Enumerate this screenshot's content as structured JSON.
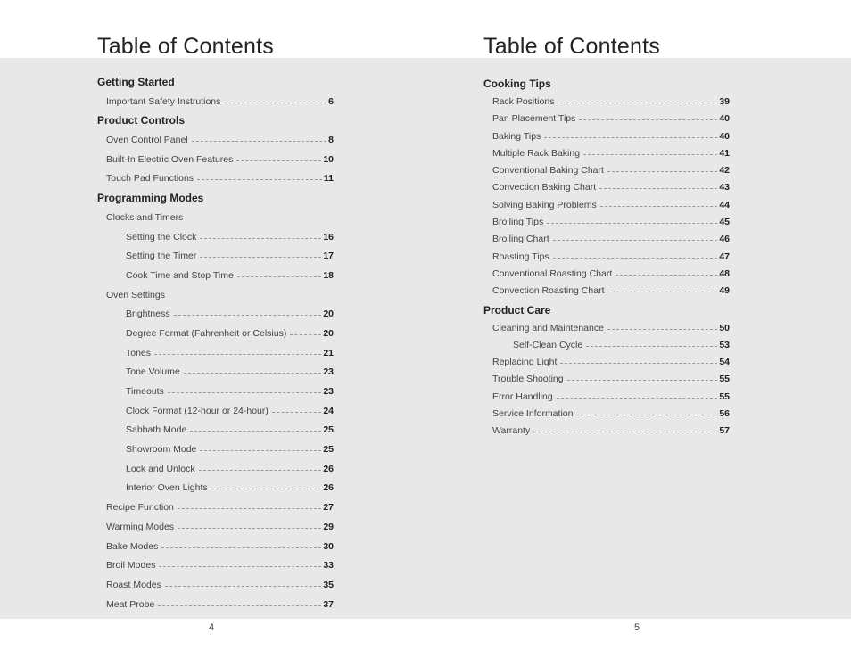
{
  "left_page": {
    "title": "Table of Contents",
    "page_number": "4",
    "rows": [
      {
        "type": "heading",
        "text": "Getting Started"
      },
      {
        "type": "entry",
        "level": 1,
        "text": "Important Safety Instrutions",
        "page": "6"
      },
      {
        "type": "heading",
        "text": "Product Controls"
      },
      {
        "type": "entry",
        "level": 1,
        "text": "Oven Control Panel",
        "page": "8"
      },
      {
        "type": "entry",
        "level": 1,
        "text": "Built-In Electric Oven Features",
        "page": "10"
      },
      {
        "type": "entry",
        "level": 1,
        "text": "Touch Pad Functions",
        "page": "11"
      },
      {
        "type": "heading",
        "text": "Programming Modes"
      },
      {
        "type": "subheading",
        "level": 1,
        "text": "Clocks and Timers"
      },
      {
        "type": "entry",
        "level": 2,
        "text": "Setting the Clock",
        "page": "16"
      },
      {
        "type": "entry",
        "level": 2,
        "text": "Setting the Timer",
        "page": "17"
      },
      {
        "type": "entry",
        "level": 2,
        "text": "Cook Time and Stop Time",
        "page": "18"
      },
      {
        "type": "subheading",
        "level": 1,
        "text": "Oven Settings"
      },
      {
        "type": "entry",
        "level": 2,
        "text": "Brightness",
        "page": "20"
      },
      {
        "type": "entry",
        "level": 2,
        "text": "Degree Format (Fahrenheit or Celsius)",
        "page": "20"
      },
      {
        "type": "entry",
        "level": 2,
        "text": "Tones",
        "page": "21"
      },
      {
        "type": "entry",
        "level": 2,
        "text": "Tone Volume",
        "page": "23"
      },
      {
        "type": "entry",
        "level": 2,
        "text": "Timeouts",
        "page": "23"
      },
      {
        "type": "entry",
        "level": 2,
        "text": "Clock Format (12-hour or 24-hour)",
        "page": "24"
      },
      {
        "type": "entry",
        "level": 2,
        "text": "Sabbath Mode",
        "page": "25"
      },
      {
        "type": "entry",
        "level": 2,
        "text": "Showroom Mode",
        "page": "25"
      },
      {
        "type": "entry",
        "level": 2,
        "text": "Lock and Unlock",
        "page": "26"
      },
      {
        "type": "entry",
        "level": 2,
        "text": "Interior Oven Lights",
        "page": "26"
      },
      {
        "type": "entry",
        "level": 1,
        "text": "Recipe Function",
        "page": "27"
      },
      {
        "type": "entry",
        "level": 1,
        "text": "Warming Modes",
        "page": "29"
      },
      {
        "type": "entry",
        "level": 1,
        "text": "Bake Modes",
        "page": "30"
      },
      {
        "type": "entry",
        "level": 1,
        "text": "Broil Modes",
        "page": "33"
      },
      {
        "type": "entry",
        "level": 1,
        "text": "Roast Modes",
        "page": "35"
      },
      {
        "type": "entry",
        "level": 1,
        "text": "Meat Probe",
        "page": "37"
      }
    ]
  },
  "right_page": {
    "title": "Table of Contents",
    "page_number": "5",
    "rows": [
      {
        "type": "heading",
        "text": "Cooking Tips"
      },
      {
        "type": "entry",
        "level": 1,
        "text": "Rack Positions",
        "page": "39"
      },
      {
        "type": "entry",
        "level": 1,
        "text": "Pan Placement Tips",
        "page": "40"
      },
      {
        "type": "entry",
        "level": 1,
        "text": "Baking Tips",
        "page": "40"
      },
      {
        "type": "entry",
        "level": 1,
        "text": "Multiple Rack Baking",
        "page": "41"
      },
      {
        "type": "entry",
        "level": 1,
        "text": "Conventional Baking Chart",
        "page": "42"
      },
      {
        "type": "entry",
        "level": 1,
        "text": "Convection Baking Chart",
        "page": "43"
      },
      {
        "type": "entry",
        "level": 1,
        "text": "Solving Baking Problems",
        "page": "44"
      },
      {
        "type": "entry",
        "level": 1,
        "text": "Broiling Tips",
        "page": "45"
      },
      {
        "type": "entry",
        "level": 1,
        "text": "Broiling Chart",
        "page": "46"
      },
      {
        "type": "entry",
        "level": 1,
        "text": "Roasting Tips",
        "page": "47"
      },
      {
        "type": "entry",
        "level": 1,
        "text": "Conventional Roasting Chart",
        "page": "48"
      },
      {
        "type": "entry",
        "level": 1,
        "text": "Convection Roasting Chart",
        "page": "49"
      },
      {
        "type": "heading",
        "text": "Product Care"
      },
      {
        "type": "entry",
        "level": 1,
        "text": "Cleaning and Maintenance",
        "page": "50"
      },
      {
        "type": "entry",
        "level": 2,
        "text": "Self-Clean Cycle",
        "page": "53"
      },
      {
        "type": "entry",
        "level": 1,
        "text": "Replacing Light",
        "page": "54"
      },
      {
        "type": "entry",
        "level": 1,
        "text": "Trouble Shooting",
        "page": "55"
      },
      {
        "type": "entry",
        "level": 1,
        "text": "Error Handling",
        "page": "55"
      },
      {
        "type": "entry",
        "level": 1,
        "text": "Service Information",
        "page": "56"
      },
      {
        "type": "entry",
        "level": 1,
        "text": "Warranty",
        "page": "57"
      }
    ]
  }
}
